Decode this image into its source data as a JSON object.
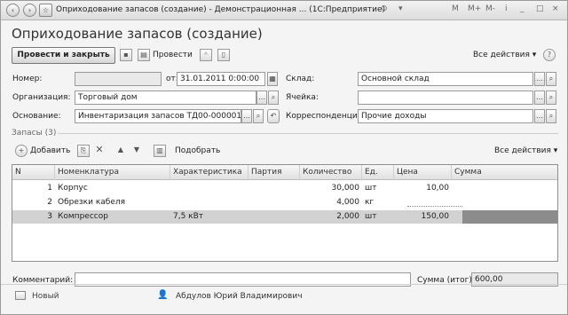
{
  "window": {
    "title": "Оприходование запасов (создание) - Демонстрационная ... (1С:Предприятие)",
    "controls": [
      "M",
      "M+",
      "M-"
    ]
  },
  "page": {
    "title": "Оприходование запасов (создание)"
  },
  "toolbar": {
    "post_close_label": "Провести и закрыть",
    "post_label": "Провести",
    "all_actions_label": "Все действия ▾"
  },
  "form": {
    "number_label": "Номер:",
    "number_value": "",
    "date_label": "от:",
    "date_value": "31.01.2011  0:00:00",
    "warehouse_label": "Склад:",
    "warehouse_value": "Основной склад",
    "organization_label": "Организация:",
    "organization_value": "Торговый дом",
    "cell_label": "Ячейка:",
    "cell_value": "",
    "basis_label": "Основание:",
    "basis_value": "Инвентаризация запасов ТД00-000001",
    "correspondence_label": "Корреспонденция:",
    "correspondence_value": "Прочие доходы"
  },
  "inventory": {
    "section_title": "Запасы (3)",
    "add_label": "Добавить",
    "pick_label": "Подобрать",
    "all_actions_label": "Все действия ▾",
    "columns": [
      "N",
      "Номенклатура",
      "Характеристика",
      "Партия",
      "Количество",
      "Ед.",
      "Цена",
      "Сумма"
    ],
    "rows": [
      {
        "n": "1",
        "item": "Корпус",
        "characteristic": "",
        "batch": "",
        "qty": "30,000",
        "unit": "шт",
        "price": "10,00",
        "sum": ""
      },
      {
        "n": "2",
        "item": "Обрезки кабеля",
        "characteristic": "",
        "batch": "",
        "qty": "4,000",
        "unit": "кг",
        "price": "",
        "sum": ""
      },
      {
        "n": "3",
        "item": "Компрессор",
        "characteristic": "7,5 кВт",
        "batch": "",
        "qty": "2,000",
        "unit": "шт",
        "price": "150,00",
        "sum": ""
      }
    ]
  },
  "footer": {
    "comment_label": "Комментарий:",
    "comment_value": "",
    "total_label": "Сумма (итог):",
    "total_value": "600,00",
    "status": "Новый",
    "author": "Абдулов Юрий Владимирович"
  }
}
